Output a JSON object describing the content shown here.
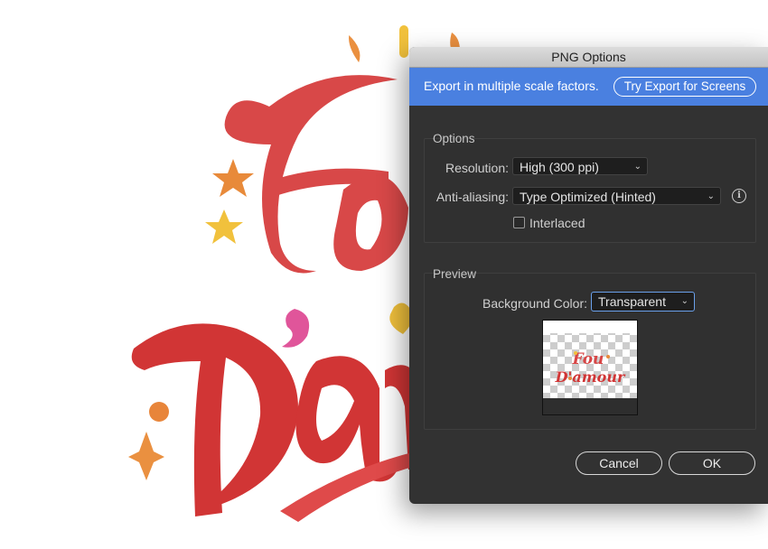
{
  "artwork": {
    "thumbnail_text_line1": "Fou",
    "thumbnail_text_line2": "D'amour"
  },
  "dialog": {
    "title": "PNG Options",
    "banner": {
      "text": "Export in multiple scale factors.",
      "button_label": "Try Export for Screens"
    },
    "options": {
      "group_title": "Options",
      "resolution_label": "Resolution:",
      "resolution_value": "High (300 ppi)",
      "antialiasing_label": "Anti-aliasing:",
      "antialiasing_value": "Type Optimized (Hinted)",
      "interlaced_label": "Interlaced",
      "interlaced_checked": false
    },
    "preview": {
      "group_title": "Preview",
      "background_color_label": "Background Color:",
      "background_color_value": "Transparent"
    },
    "buttons": {
      "cancel": "Cancel",
      "ok": "OK"
    }
  },
  "colors": {
    "banner_blue": "#4a80e0",
    "dialog_bg": "#323232",
    "art_red": "#d84545",
    "art_orange": "#e8853a",
    "art_yellow": "#f0bf3c",
    "art_pink": "#e0559a"
  }
}
